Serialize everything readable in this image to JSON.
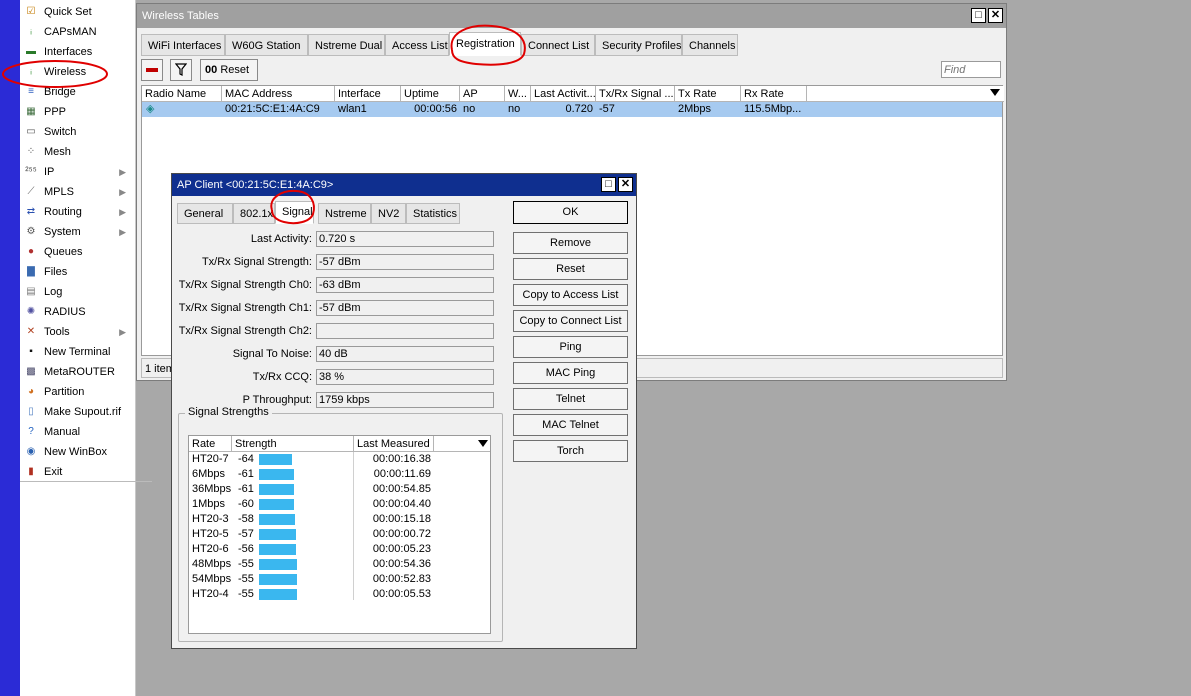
{
  "menu": {
    "items": [
      {
        "label": "Quick Set",
        "icon": "quick-set-icon",
        "glyph": "☑",
        "color": "#c27a00",
        "arrow": false
      },
      {
        "label": "CAPsMAN",
        "icon": "capsman-icon",
        "glyph": "ᵢ",
        "color": "#2a8a2a",
        "arrow": false
      },
      {
        "label": "Interfaces",
        "icon": "interfaces-icon",
        "glyph": "▬",
        "color": "#2a7a2a",
        "arrow": false
      },
      {
        "label": "Wireless",
        "icon": "wireless-icon",
        "glyph": "ᵢ",
        "color": "#2a8a2a",
        "arrow": false
      },
      {
        "label": "Bridge",
        "icon": "bridge-icon",
        "glyph": "≡",
        "color": "#3060c0",
        "arrow": false
      },
      {
        "label": "PPP",
        "icon": "ppp-icon",
        "glyph": "▦",
        "color": "#3a6a3a",
        "arrow": false
      },
      {
        "label": "Switch",
        "icon": "switch-icon",
        "glyph": "▭",
        "color": "#555",
        "arrow": false
      },
      {
        "label": "Mesh",
        "icon": "mesh-icon",
        "glyph": "⁘",
        "color": "#444",
        "arrow": false
      },
      {
        "label": "IP",
        "icon": "ip-icon",
        "glyph": "²⁵⁵",
        "color": "#444",
        "arrow": true
      },
      {
        "label": "MPLS",
        "icon": "mpls-icon",
        "glyph": "⟋",
        "color": "#666",
        "arrow": true
      },
      {
        "label": "Routing",
        "icon": "routing-icon",
        "glyph": "⇄",
        "color": "#2a50b0",
        "arrow": true
      },
      {
        "label": "System",
        "icon": "system-icon",
        "glyph": "⚙",
        "color": "#555",
        "arrow": true
      },
      {
        "label": "Queues",
        "icon": "queues-icon",
        "glyph": "●",
        "color": "#b03030",
        "arrow": false
      },
      {
        "label": "Files",
        "icon": "files-icon",
        "glyph": "▇",
        "color": "#3a6ab0",
        "arrow": false
      },
      {
        "label": "Log",
        "icon": "log-icon",
        "glyph": "▤",
        "color": "#777",
        "arrow": false
      },
      {
        "label": "RADIUS",
        "icon": "radius-icon",
        "glyph": "✺",
        "color": "#5050a0",
        "arrow": false
      },
      {
        "label": "Tools",
        "icon": "tools-icon",
        "glyph": "✕",
        "color": "#b04020",
        "arrow": true
      },
      {
        "label": "New Terminal",
        "icon": "terminal-icon",
        "glyph": "▪",
        "color": "#111",
        "arrow": false
      },
      {
        "label": "MetaROUTER",
        "icon": "metarouter-icon",
        "glyph": "▩",
        "color": "#446",
        "arrow": false
      },
      {
        "label": "Partition",
        "icon": "partition-icon",
        "glyph": "◕",
        "color": "#d07020",
        "arrow": false
      },
      {
        "label": "Make Supout.rif",
        "icon": "supout-icon",
        "glyph": "▯",
        "color": "#4a7ac0",
        "arrow": false
      },
      {
        "label": "Manual",
        "icon": "manual-icon",
        "glyph": "?",
        "color": "#2060c0",
        "arrow": false
      },
      {
        "label": "New WinBox",
        "icon": "winbox-icon",
        "glyph": "◉",
        "color": "#2a60b0",
        "arrow": false
      },
      {
        "label": "Exit",
        "icon": "exit-icon",
        "glyph": "▮",
        "color": "#b03020",
        "arrow": false
      }
    ]
  },
  "wireless_tables": {
    "title": "Wireless Tables",
    "tabs": [
      "WiFi Interfaces",
      "W60G Station",
      "Nstreme Dual",
      "Access List",
      "Registration",
      "Connect List",
      "Security Profiles",
      "Channels"
    ],
    "active_tab": "Registration",
    "reset_label": "Reset",
    "reset_prefix": "00",
    "find_placeholder": "Find",
    "columns": [
      "Radio Name",
      "MAC Address",
      "Interface",
      "Uptime",
      "AP",
      "W...",
      "Last Activit...",
      "Tx/Rx Signal ...",
      "Tx Rate",
      "Rx Rate"
    ],
    "rows": [
      {
        "radio_name": "",
        "mac": "00:21:5C:E1:4A:C9",
        "interface": "wlan1",
        "uptime": "00:00:56",
        "ap": "no",
        "w": "no",
        "last_activity": "0.720",
        "signal": "-57",
        "tx_rate": "2Mbps",
        "rx_rate": "115.5Mbp..."
      }
    ],
    "status": "1 item"
  },
  "ap_client": {
    "title": "AP Client <00:21:5C:E1:4A:C9>",
    "tabs": [
      "General",
      "802.1x",
      "Signal",
      "Nstreme",
      "NV2",
      "Statistics"
    ],
    "active_tab": "Signal",
    "fields": [
      {
        "label": "Last Activity:",
        "value": "0.720 s"
      },
      {
        "label": "Tx/Rx Signal Strength:",
        "value": "-57 dBm"
      },
      {
        "label": "Tx/Rx Signal Strength Ch0:",
        "value": "-63 dBm"
      },
      {
        "label": "Tx/Rx Signal Strength Ch1:",
        "value": "-57 dBm"
      },
      {
        "label": "Tx/Rx Signal Strength Ch2:",
        "value": ""
      },
      {
        "label": "Signal To Noise:",
        "value": "40 dB"
      },
      {
        "label": "Tx/Rx CCQ:",
        "value": "38 %"
      },
      {
        "label": "P Throughput:",
        "value": "1759 kbps"
      }
    ],
    "buttons": [
      "OK",
      "Remove",
      "Reset",
      "Copy to Access List",
      "Copy to Connect List",
      "Ping",
      "MAC Ping",
      "Telnet",
      "MAC Telnet",
      "Torch"
    ],
    "signal_strengths": {
      "title": "Signal Strengths",
      "columns": [
        "Rate",
        "Strength",
        "Last Measured"
      ],
      "bar_color": "#3ab7ef",
      "rows": [
        {
          "rate": "HT20-7",
          "strength": "-64",
          "last": "00:00:16.38"
        },
        {
          "rate": "6Mbps",
          "strength": "-61",
          "last": "00:00:11.69"
        },
        {
          "rate": "36Mbps",
          "strength": "-61",
          "last": "00:00:54.85"
        },
        {
          "rate": "1Mbps",
          "strength": "-60",
          "last": "00:00:04.40"
        },
        {
          "rate": "HT20-3",
          "strength": "-58",
          "last": "00:00:15.18"
        },
        {
          "rate": "HT20-5",
          "strength": "-57",
          "last": "00:00:00.72"
        },
        {
          "rate": "HT20-6",
          "strength": "-56",
          "last": "00:00:05.23"
        },
        {
          "rate": "48Mbps",
          "strength": "-55",
          "last": "00:00:54.36"
        },
        {
          "rate": "54Mbps",
          "strength": "-55",
          "last": "00:00:52.83"
        },
        {
          "rate": "HT20-4",
          "strength": "-55",
          "last": "00:00:05.53"
        }
      ]
    }
  }
}
